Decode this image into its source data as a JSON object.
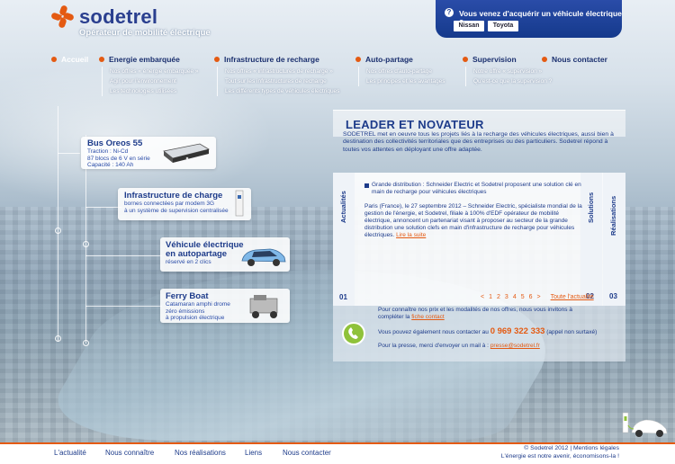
{
  "header": {
    "brand": "sodetrel",
    "tagline": "Opérateur de mobilité électrique",
    "promo_question": "Vous venez d'acquérir un véhicule électrique ?",
    "promo_icon": "?",
    "promo_buttons": [
      "Nissan",
      "Toyota"
    ]
  },
  "nav": [
    {
      "label": "Accueil",
      "sub": []
    },
    {
      "label": "Energie embarquée",
      "sub": [
        "Nos offres « énergie embarquée »",
        "Agir pour l'environnement",
        "Les technologies utilisées"
      ]
    },
    {
      "label": "Infrastructure de recharge",
      "sub": [
        "Nos offres « infrastructures de recharge »",
        "Tout sur les infrastructures de recharge",
        "Les différents types de véhicules électriques"
      ]
    },
    {
      "label": "Auto-partage",
      "sub": [
        "Nos offres d'auto-partage",
        "Les principes et les avantages"
      ]
    },
    {
      "label": "Supervision",
      "sub": [
        "Notre offre « supervision »",
        "Qu'est-ce que la supervision ?"
      ]
    },
    {
      "label": "Nous contacter",
      "sub": []
    }
  ],
  "cards": [
    {
      "title": "Bus Oreos 55",
      "lines": [
        "Traction : Ni-Cd",
        "87 blocs de 6 V en série",
        "Capacité : 140 Ah"
      ]
    },
    {
      "title": "Infrastructure de charge",
      "lines": [
        "bornes connectées par modem 3G",
        "à un système de supervision centralisée"
      ]
    },
    {
      "title": "Véhicule électrique",
      "title2": "en autopartage",
      "lines": [
        "réservé en 2 clics"
      ]
    },
    {
      "title": "Ferry Boat",
      "lines": [
        "Catamaran amphi drome",
        "zéro émissions",
        "à propulsion électrique"
      ]
    }
  ],
  "main": {
    "title": "LEADER ET NOVATEUR",
    "intro": "SODETREL met en oeuvre tous les projets liés à la recharge des véhicules électriques, aussi bien à destination des collectivités territoriales que des entreprises ou des particuliers. Sodetrel répond à toutes vos attentes en déployant une offre adaptée."
  },
  "tabs": {
    "left": {
      "label": "Actualités",
      "num": "01"
    },
    "mid": {
      "label": "Solutions",
      "num": "02"
    },
    "right": {
      "label": "Réalisations",
      "num": "03"
    }
  },
  "news": {
    "headline": "Grande distribution : Schneider Electric et Sodetrel proposent une solution clé en main de recharge pour véhicules électriques",
    "body": "Paris (France), le 27 septembre 2012 – Schneider Electric, spécialiste mondial de la gestion de l'énergie, et Sodetrel, filiale à 100% d'EDF opérateur de mobilité électrique, annoncent un partenariat visant à proposer au secteur de la grande distribution une solution clefs en main d'infrastructure de recharge pour véhicules électriques.",
    "more": "Lire la suite",
    "pages": [
      "<",
      "1",
      "2",
      "3",
      "4",
      "5",
      "6",
      ">"
    ],
    "all_news": "Toute l'actualité"
  },
  "contact": {
    "line1": "Pour connaître nos prix et les modalités de nos offres, nous vous invitons à",
    "line2_prefix": "compléter la",
    "line2_link": "fiche contact",
    "line3_prefix": "Vous pouvez également nous contacter au",
    "phone": "0 969 322 333",
    "phone_note": "(appel non surtaxé)",
    "press_prefix": "Pour la presse, merci d'envoyer un mail à :",
    "press_mail": "presse@sodetrel.fr"
  },
  "footer": {
    "links": [
      "L'actualité",
      "Nous connaître",
      "Nos réalisations",
      "Liens",
      "Nous contacter"
    ],
    "copyright": "© Sodetrel 2012 | Mentions légales",
    "slogan": "L'énergie est notre avenir, économisons-la !"
  },
  "colors": {
    "accent": "#e45a12",
    "navy": "#1d3b8a",
    "green": "#8fc23a"
  }
}
